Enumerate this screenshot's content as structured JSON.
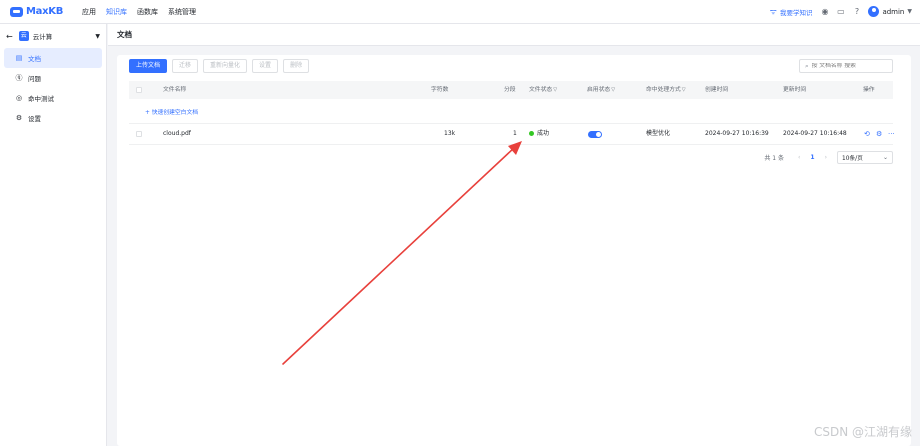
{
  "app": {
    "logo_text": "MaxKB"
  },
  "nav": {
    "items": [
      "应用",
      "知识库",
      "函数库",
      "系统管理"
    ],
    "active_index": 1
  },
  "topbar": {
    "study_link": "我要学知识",
    "username": "admin"
  },
  "sidebar": {
    "kb_badge": "云",
    "kb_name": "云计算",
    "menu": [
      {
        "label": "文档",
        "icon": "document-icon",
        "active": true
      },
      {
        "label": "问题",
        "icon": "question-icon",
        "active": false
      },
      {
        "label": "命中测试",
        "icon": "target-icon",
        "active": false
      },
      {
        "label": "设置",
        "icon": "gear-icon",
        "active": false
      }
    ]
  },
  "main": {
    "title": "文档",
    "toolbar": {
      "upload": "上传文档",
      "migrate": "迁移",
      "revectorize": "重新向量化",
      "settings": "设置",
      "delete": "删除"
    },
    "search_placeholder": "按 文档名称 搜索",
    "table": {
      "headers": [
        "文件名称",
        "字符数",
        "分段",
        "文件状态",
        "启用状态",
        "命中处理方式",
        "创建时间",
        "更新时间",
        "操作"
      ],
      "quick_create": "+ 快速创建空白文档",
      "rows": [
        {
          "name": "cloud.pdf",
          "chars": "13k",
          "segments": "1",
          "status": "成功",
          "enabled": true,
          "hit_mode": "模型优化",
          "created": "2024-09-27 10:16:39",
          "updated": "2024-09-27 10:16:48"
        }
      ]
    },
    "pagination": {
      "total": "共 1 条",
      "current": "1",
      "page_size": "10条/页"
    }
  },
  "annotation": {
    "arrow_color": "#e8413c"
  },
  "watermark": "CSDN @江湖有缘"
}
